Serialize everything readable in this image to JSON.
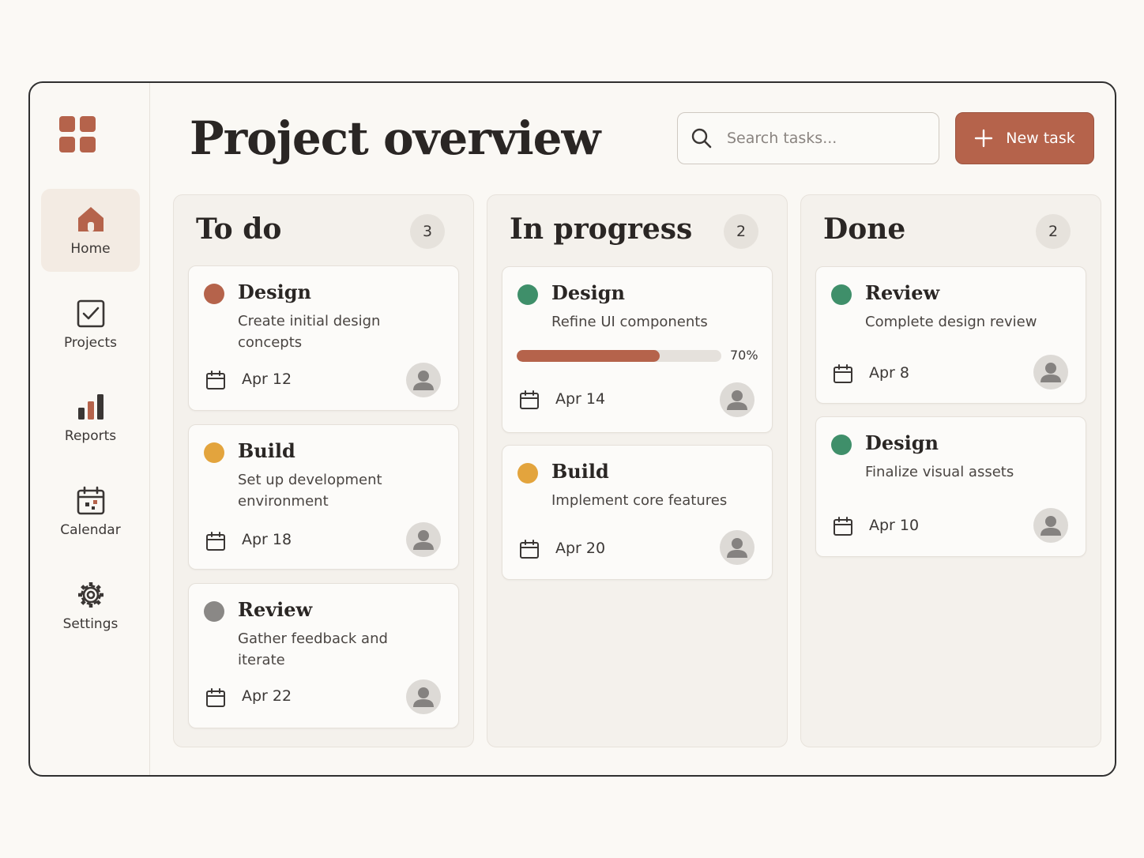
{
  "header": {
    "title": "Project overview",
    "search_placeholder": "Search tasks...",
    "new_task_label": "New task"
  },
  "sidebar": {
    "items": [
      {
        "label": "Home",
        "icon": "home-icon",
        "active": true
      },
      {
        "label": "Projects",
        "icon": "checkbox-icon"
      },
      {
        "label": "Reports",
        "icon": "bar-chart-icon"
      },
      {
        "label": "Calendar",
        "icon": "calendar-icon"
      },
      {
        "label": "Settings",
        "icon": "gear-icon"
      }
    ]
  },
  "colors": {
    "accent": "#b5634b",
    "red": "#b5634b",
    "orange": "#e3a43d",
    "green": "#3f8f6a",
    "gray": "#8a8886"
  },
  "columns": [
    {
      "title": "To do",
      "count": "3",
      "cards": [
        {
          "title": "Design",
          "status_color": "red",
          "desc": "Create initial design concepts",
          "date": "Apr 12"
        },
        {
          "title": "Build",
          "status_color": "orange",
          "desc": "Set up development environment",
          "date": "Apr 18"
        },
        {
          "title": "Review",
          "status_color": "gray",
          "desc": "Gather feedback and iterate",
          "date": "Apr 22"
        }
      ]
    },
    {
      "title": "In progress",
      "count": "2",
      "cards": [
        {
          "title": "Design",
          "status_color": "green",
          "desc": "Refine UI components",
          "date": "Apr 14",
          "progress": 0.7,
          "progress_label": "70%"
        },
        {
          "title": "Build",
          "status_color": "orange",
          "desc": "Implement core features",
          "date": "Apr 20"
        }
      ]
    },
    {
      "title": "Done",
      "count": "2",
      "cards": [
        {
          "title": "Review",
          "status_color": "green",
          "desc": "Complete design review",
          "date": "Apr 8"
        },
        {
          "title": "Design",
          "status_color": "green",
          "desc": "Finalize visual assets",
          "date": "Apr 10"
        }
      ]
    }
  ]
}
